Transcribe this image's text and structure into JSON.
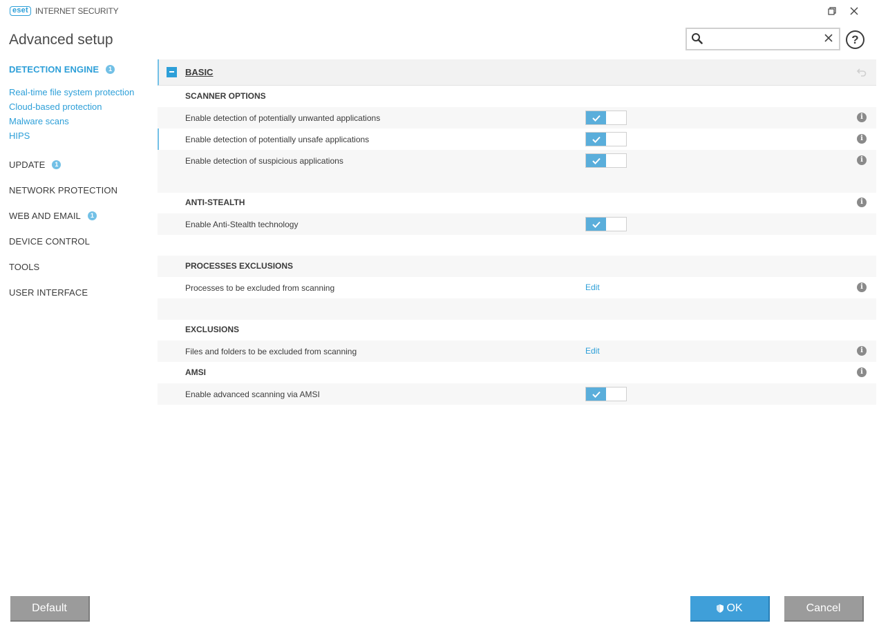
{
  "titlebar": {
    "logo_text": "eset",
    "product_name": "INTERNET SECURITY"
  },
  "header": {
    "title": "Advanced setup",
    "search": {
      "value": "",
      "placeholder": ""
    },
    "help_label": "?"
  },
  "sidebar": {
    "sections": [
      {
        "label": "DETECTION ENGINE",
        "badge": "1",
        "active": true
      },
      {
        "label": "UPDATE",
        "badge": "1"
      },
      {
        "label": "NETWORK PROTECTION"
      },
      {
        "label": "WEB AND EMAIL",
        "badge": "1"
      },
      {
        "label": "DEVICE CONTROL"
      },
      {
        "label": "TOOLS"
      },
      {
        "label": "USER INTERFACE"
      }
    ],
    "sub_items": [
      "Real-time file system protection",
      "Cloud-based protection",
      "Malware scans",
      "HIPS"
    ]
  },
  "main": {
    "section_title": "BASIC",
    "scanner_options": {
      "heading": "SCANNER OPTIONS",
      "items": [
        {
          "label": "Enable detection of potentially unwanted applications",
          "enabled": true
        },
        {
          "label": "Enable detection of potentially unsafe applications",
          "enabled": true
        },
        {
          "label": "Enable detection of suspicious applications",
          "enabled": true
        }
      ]
    },
    "anti_stealth": {
      "heading": "ANTI-STEALTH",
      "items": [
        {
          "label": "Enable Anti-Stealth technology",
          "enabled": true
        }
      ]
    },
    "processes_exclusions": {
      "heading": "PROCESSES EXCLUSIONS",
      "items": [
        {
          "label": "Processes to be excluded from scanning",
          "action": "Edit"
        }
      ]
    },
    "exclusions": {
      "heading": "EXCLUSIONS",
      "items": [
        {
          "label": "Files and folders to be excluded from scanning",
          "action": "Edit"
        }
      ]
    },
    "amsi": {
      "heading": "AMSI",
      "items": [
        {
          "label": "Enable advanced scanning via AMSI",
          "enabled": true
        }
      ]
    },
    "info_glyph": "i"
  },
  "footer": {
    "default_label": "Default",
    "ok_label": "OK",
    "cancel_label": "Cancel"
  },
  "colors": {
    "accent": "#2d9fd8",
    "toggle_on": "#5aaedb",
    "button_gray": "#9b9b9b",
    "button_ok": "#3f9fd9"
  },
  "icons": {
    "search": "search-icon",
    "clear": "clear-icon",
    "restore": "restore-icon",
    "close": "close-icon",
    "revert": "revert-icon",
    "info": "info-icon",
    "check": "check-icon",
    "shield": "shield-icon"
  }
}
